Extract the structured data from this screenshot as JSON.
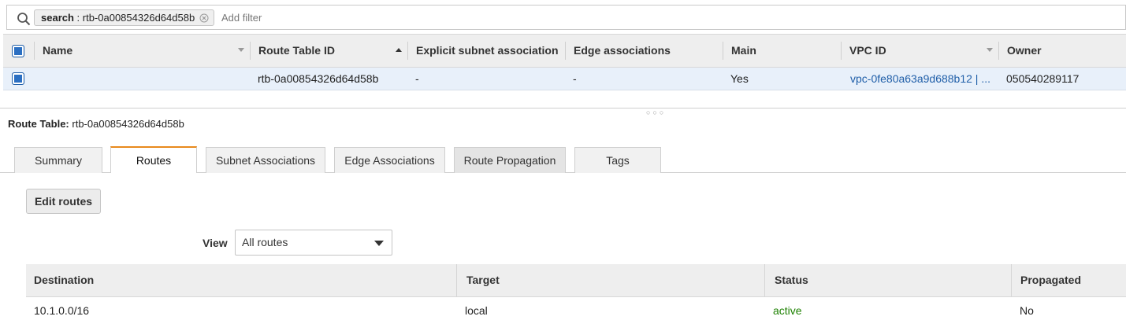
{
  "filter": {
    "chip_key": "search",
    "chip_separator": " : ",
    "chip_value": "rtb-0a00854326d64d58b",
    "add_filter_placeholder": "Add filter"
  },
  "route_tables": {
    "columns": [
      "Name",
      "Route Table ID",
      "Explicit subnet association",
      "Edge associations",
      "Main",
      "VPC ID",
      "Owner"
    ],
    "rows": [
      {
        "selected": true,
        "name": "",
        "route_table_id": "rtb-0a00854326d64d58b",
        "explicit_subnet_association": "-",
        "edge_associations": "-",
        "main": "Yes",
        "vpc_id": "vpc-0fe80a63a9d688b12 | ...",
        "owner": "050540289117"
      }
    ]
  },
  "detail": {
    "label": "Route Table:",
    "route_table_id": "rtb-0a00854326d64d58b"
  },
  "tabs": [
    {
      "label": "Summary",
      "active": false
    },
    {
      "label": "Routes",
      "active": true
    },
    {
      "label": "Subnet Associations",
      "active": false
    },
    {
      "label": "Edge Associations",
      "active": false
    },
    {
      "label": "Route Propagation",
      "active": false
    },
    {
      "label": "Tags",
      "active": false
    }
  ],
  "routes_panel": {
    "edit_button_label": "Edit routes",
    "view_label": "View",
    "view_selected": "All routes",
    "columns": [
      "Destination",
      "Target",
      "Status",
      "Propagated"
    ],
    "rows": [
      {
        "destination": "10.1.0.0/16",
        "target": "local",
        "status": "active",
        "propagated": "No"
      }
    ]
  },
  "colors": {
    "link": "#1f5ea8",
    "status_active": "#1d8102",
    "active_tab_accent": "#e88a1c",
    "selected_row_bg": "#e8f0fa",
    "header_bg": "#eeeeee"
  },
  "icons": [
    "search-icon",
    "clear-filter-icon",
    "sort-caret-icon",
    "dropdown-caret-icon",
    "splitter-handle-icon"
  ]
}
